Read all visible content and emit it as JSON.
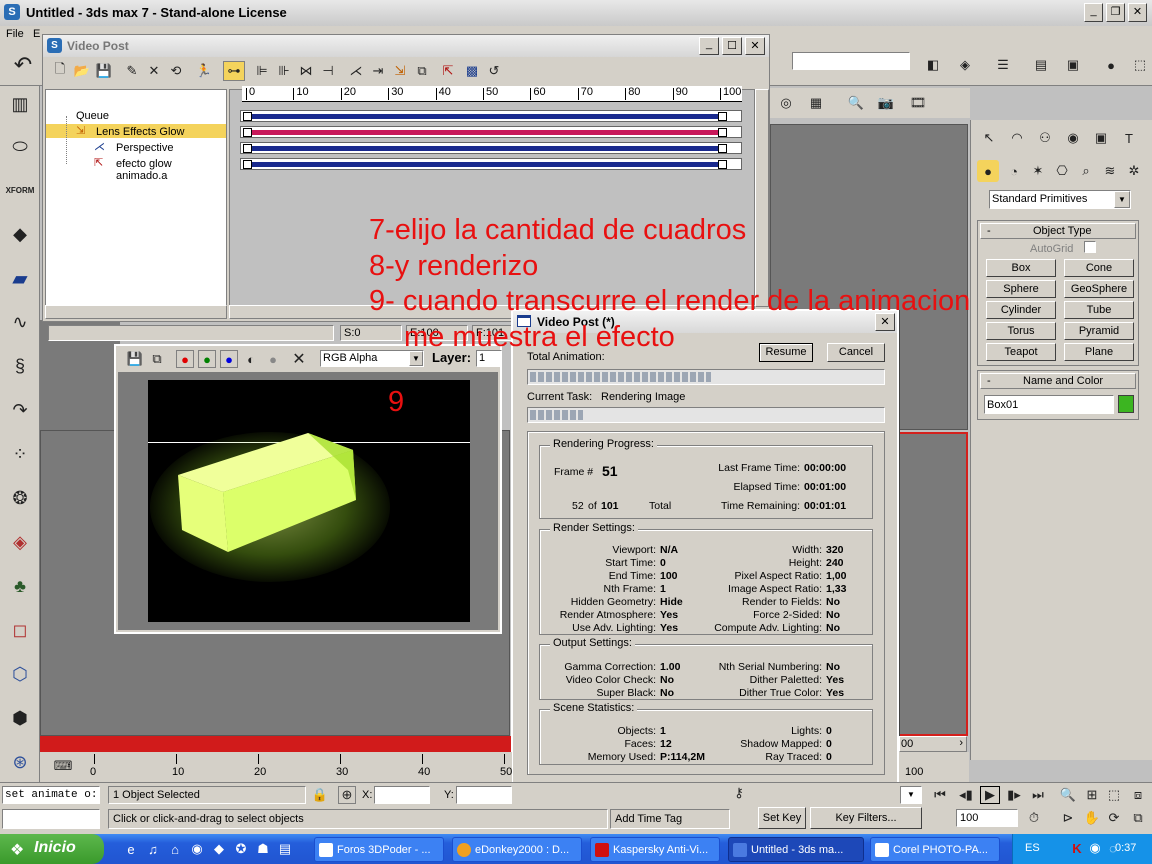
{
  "app": {
    "title": "Untitled - 3ds max 7  - Stand-alone License",
    "menu": [
      "File",
      "E"
    ]
  },
  "videopost": {
    "title": "Video Post",
    "queue": [
      {
        "label": "Queue"
      },
      {
        "label": "Lens Effects Glow"
      },
      {
        "label": "Perspective"
      },
      {
        "label": "efecto glow animado.a"
      }
    ],
    "ruler": [
      "0",
      "10",
      "20",
      "30",
      "40",
      "50",
      "60",
      "70",
      "80",
      "90",
      "100"
    ],
    "status": {
      "s": "S:0",
      "e": "E:100",
      "f": "F:101"
    }
  },
  "frame_window": {
    "channel": "RGB Alpha",
    "layer_label": "Layer:",
    "layer_value": "1"
  },
  "progress_dialog": {
    "title": "Video Post (*)",
    "resume": "Resume",
    "cancel": "Cancel",
    "total_animation_label": "Total Animation:",
    "current_task_label": "Current Task:",
    "current_task_value": "Rendering Image",
    "total_progress": 0.51,
    "task_progress": 0.15,
    "rendering_progress": {
      "title": "Rendering Progress:",
      "frame_label": "Frame #",
      "frame_value": "51",
      "count": "52",
      "of": "of",
      "total_frames": "101",
      "total_label": "Total",
      "last_frame_time_label": "Last Frame Time:",
      "last_frame_time": "00:00:00",
      "elapsed_time_label": "Elapsed Time:",
      "elapsed_time": "00:01:00",
      "time_remaining_label": "Time Remaining:",
      "time_remaining": "00:01:01"
    },
    "render_settings": {
      "title": "Render Settings:",
      "left": [
        {
          "label": "Viewport:",
          "value": "N/A"
        },
        {
          "label": "Start Time:",
          "value": "0"
        },
        {
          "label": "End Time:",
          "value": "100"
        },
        {
          "label": "Nth Frame:",
          "value": "1"
        },
        {
          "label": "Hidden Geometry:",
          "value": "Hide"
        },
        {
          "label": "Render Atmosphere:",
          "value": "Yes"
        },
        {
          "label": "Use Adv. Lighting:",
          "value": "Yes"
        }
      ],
      "right": [
        {
          "label": "Width:",
          "value": "320"
        },
        {
          "label": "Height:",
          "value": "240"
        },
        {
          "label": "Pixel Aspect Ratio:",
          "value": "1,00"
        },
        {
          "label": "Image Aspect Ratio:",
          "value": "1,33"
        },
        {
          "label": "Render to Fields:",
          "value": "No"
        },
        {
          "label": "Force 2-Sided:",
          "value": "No"
        },
        {
          "label": "Compute Adv. Lighting:",
          "value": "No"
        }
      ]
    },
    "output_settings": {
      "title": "Output Settings:",
      "left": [
        {
          "label": "Gamma Correction:",
          "value": "1.00"
        },
        {
          "label": "Video Color Check:",
          "value": "No"
        },
        {
          "label": "Super Black:",
          "value": "No"
        }
      ],
      "right": [
        {
          "label": "Nth Serial Numbering:",
          "value": "No"
        },
        {
          "label": "Dither Paletted:",
          "value": "Yes"
        },
        {
          "label": "Dither True Color:",
          "value": "Yes"
        }
      ]
    },
    "scene_statistics": {
      "title": "Scene Statistics:",
      "left": [
        {
          "label": "Objects:",
          "value": "1"
        },
        {
          "label": "Faces:",
          "value": "12"
        },
        {
          "label": "Memory Used:",
          "value": "P:114,2M"
        }
      ],
      "right": [
        {
          "label": "Lights:",
          "value": "0"
        },
        {
          "label": "Shadow Mapped:",
          "value": "0"
        },
        {
          "label": "Ray Traced:",
          "value": "0"
        }
      ]
    }
  },
  "annotations": {
    "line1": "7-elijo la cantidad de cuadros",
    "line2": "8-y renderizo",
    "line3": "9- cuando transcurre el render de la animacion",
    "line4": "me muestra el efecto",
    "marker": "9"
  },
  "command_panel": {
    "dropdown": "Standard Primitives",
    "object_type_title": "Object Type",
    "autogrid": "AutoGrid",
    "buttons": [
      "Box",
      "Cone",
      "Sphere",
      "GeoSphere",
      "Cylinder",
      "Tube",
      "Torus",
      "Pyramid",
      "Teapot",
      "Plane"
    ],
    "name_color_title": "Name and Color",
    "name_value": "Box01",
    "color": "#3cb521"
  },
  "timeline": {
    "ticks": [
      "0",
      "10",
      "20",
      "30",
      "40",
      "50"
    ],
    "tick_right": "100",
    "slider_right": "00"
  },
  "status_bar": {
    "maxscript": "set animate o:",
    "selection": "1 Object Selected",
    "prompt": "Click or click-and-drag to select objects",
    "x_label": "X:",
    "y_label": "Y:",
    "add_time_tag": "Add Time Tag",
    "set_key": "Set Key",
    "key_filters": "Key Filters...",
    "frame_field": "100"
  },
  "taskbar": {
    "start": "Inicio",
    "items": [
      "Foros 3DPoder - ...",
      "eDonkey2000 : D...",
      "Kaspersky Anti-Vi...",
      "Untitled - 3ds ma...",
      "Corel PHOTO-PA..."
    ],
    "lang": "ES",
    "clock": "0:37"
  }
}
